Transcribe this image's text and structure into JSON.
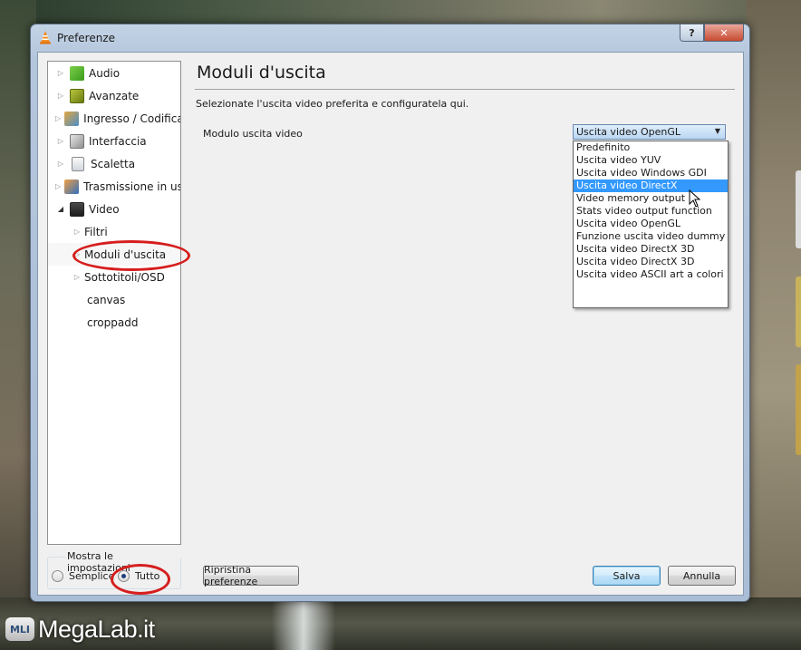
{
  "window": {
    "title": "Preferenze",
    "help_glyph": "?",
    "close_glyph": "✕"
  },
  "sidebar": {
    "items": [
      {
        "label": "Audio",
        "icon": "music-note-icon"
      },
      {
        "label": "Avanzate",
        "icon": "chip-icon"
      },
      {
        "label": "Ingresso / Codificatori",
        "icon": "input-codec-icon"
      },
      {
        "label": "Interfaccia",
        "icon": "interface-icon"
      },
      {
        "label": "Scaletta",
        "icon": "playlist-icon"
      },
      {
        "label": "Trasmissione in uscita",
        "icon": "stream-output-icon"
      },
      {
        "label": "Video",
        "icon": "film-strip-icon"
      },
      {
        "label": "Filtri"
      },
      {
        "label": "Moduli d'uscita"
      },
      {
        "label": "Sottotitoli/OSD"
      },
      {
        "label": "canvas"
      },
      {
        "label": "croppadd"
      }
    ]
  },
  "settings_mode": {
    "legend": "Mostra le impostazioni",
    "options": [
      {
        "label": "Semplice",
        "selected": false
      },
      {
        "label": "Tutto",
        "selected": true
      }
    ]
  },
  "main": {
    "title": "Moduli d'uscita",
    "description": "Selezionate l'uscita video preferita e configuratela qui.",
    "field_label": "Modulo uscita video",
    "selected_value": "Uscita video OpenGL",
    "options": [
      "Predefinito",
      "Uscita video YUV",
      "Uscita video Windows GDI",
      "Uscita video DirectX",
      "Video memory output",
      "Stats video output function",
      "Uscita video OpenGL",
      "Funzione uscita video dummy",
      "Uscita video DirectX 3D",
      "Uscita video DirectX 3D",
      "Uscita video ASCII art a colori"
    ],
    "highlighted_option": "Uscita video DirectX"
  },
  "buttons": {
    "reset": "Ripristina preferenze",
    "save": "Salva",
    "cancel": "Annulla"
  },
  "watermark": {
    "badge": "MLI",
    "text": "MegaLab.it"
  },
  "colors": {
    "highlight": "#3399ff",
    "annotation": "#d61e1e"
  }
}
